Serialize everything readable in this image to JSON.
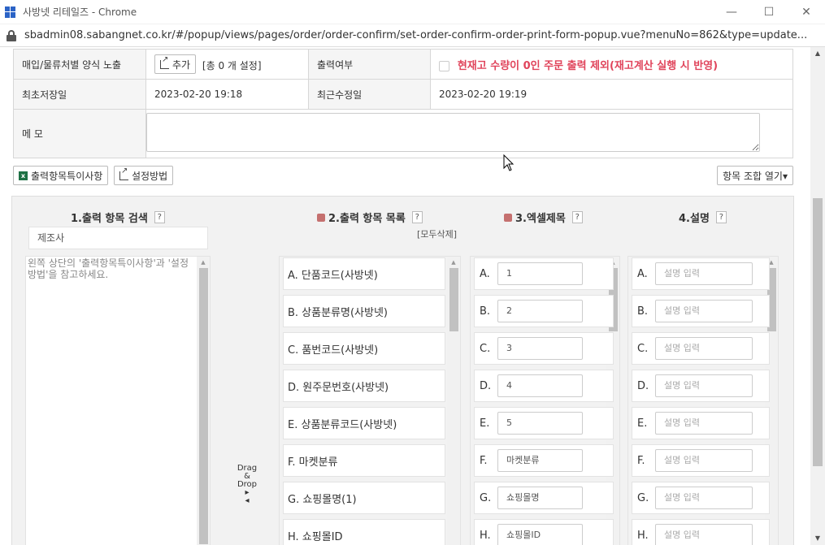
{
  "window": {
    "title": "사방넷 리테일즈 - Chrome",
    "url": "sbadmin08.sabangnet.co.kr/#/popup/views/pages/order/order-confirm/set-order-confirm-order-print-form-popup.vue?menuNo=862&type=update..."
  },
  "info": {
    "row1_label": "매입/물류처별 양식 노출",
    "add_button": "추가",
    "count_text": "[총 0 개 설정]",
    "print_label": "출력여부",
    "print_warning": "현재고 수량이 0인 주문 출력 제외(재고계산 실행 시 반영)",
    "created_label": "최초저장일",
    "created_value": "2023-02-20 19:18",
    "modified_label": "최근수정일",
    "modified_value": "2023-02-20 19:19",
    "memo_label": "메 모"
  },
  "toolbar": {
    "special_items_button": "출력항목특이사항",
    "settings_method_button": "설정방법",
    "combo_button": "항목 조합 열기▾"
  },
  "columns": {
    "search_title": "1.출력 항목 검색",
    "list_title": "2.출력 항목 목록",
    "excel_title": "3.엑셀제목",
    "desc_title": "4.설명",
    "help": "?",
    "delete_all": "[모두삭제]",
    "search_value": "제조사",
    "hint": "왼쪽 상단의 '출력항목특이사항'과 '설정방법'을 참고하세요.",
    "drag_drop": [
      "Drag",
      "&",
      "Drop",
      "▸",
      "◂"
    ]
  },
  "items": [
    {
      "label": "A. 단품코드(사방넷)",
      "letter": "A.",
      "excel": "1",
      "desc_placeholder": "설명 입력"
    },
    {
      "label": "B. 상품분류명(사방넷)",
      "letter": "B.",
      "excel": "2",
      "desc_placeholder": "설명 입력"
    },
    {
      "label": "C. 품번코드(사방넷)",
      "letter": "C.",
      "excel": "3",
      "desc_placeholder": "설명 입력"
    },
    {
      "label": "D. 원주문번호(사방넷)",
      "letter": "D.",
      "excel": "4",
      "desc_placeholder": "설명 입력"
    },
    {
      "label": "E. 상품분류코드(사방넷)",
      "letter": "E.",
      "excel": "5",
      "desc_placeholder": "설명 입력"
    },
    {
      "label": "F. 마켓분류",
      "letter": "F.",
      "excel": "마켓분류",
      "desc_placeholder": "설명 입력"
    },
    {
      "label": "G. 쇼핑몰명(1)",
      "letter": "G.",
      "excel": "쇼핑몰명",
      "desc_placeholder": "설명 입력"
    },
    {
      "label": "H. 쇼핑몰ID",
      "letter": "H.",
      "excel": "쇼핑몰ID",
      "desc_placeholder": "설명 입력"
    }
  ]
}
